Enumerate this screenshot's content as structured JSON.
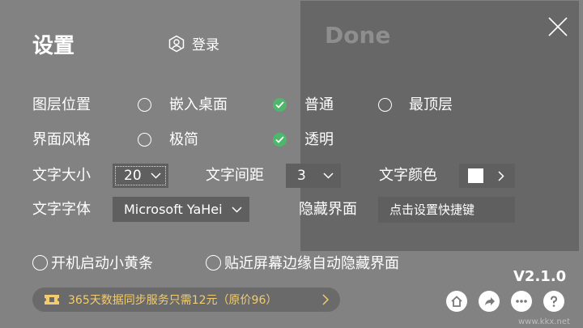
{
  "header": {
    "title": "设置",
    "login_label": "登录"
  },
  "preview": {
    "done_text": "Done"
  },
  "layer": {
    "label": "图层位置",
    "options": [
      {
        "label": "嵌入桌面",
        "checked": false
      },
      {
        "label": "普通",
        "checked": true
      },
      {
        "label": "最顶层",
        "checked": false
      }
    ]
  },
  "style": {
    "label": "界面风格",
    "options": [
      {
        "label": "极简",
        "checked": false
      },
      {
        "label": "透明",
        "checked": true
      }
    ]
  },
  "font_size": {
    "label": "文字大小",
    "value": "20"
  },
  "letter_spacing": {
    "label": "文字间距",
    "value": "3"
  },
  "text_color": {
    "label": "文字颜色",
    "value": "#ffffff"
  },
  "font_family": {
    "label": "文字字体",
    "value": "Microsoft YaHei"
  },
  "hide_ui": {
    "label": "隐藏界面",
    "hotkey_placeholder": "点击设置快捷键"
  },
  "checkboxes": {
    "autostart": {
      "label": "开机启动小黄条",
      "checked": false
    },
    "edge_hide": {
      "label": "贴近屏幕边缘自动隐藏界面",
      "checked": false
    }
  },
  "version": "V2.1.0",
  "promo": {
    "text": "365天数据同步服务只需12元（原价96）"
  },
  "watermark": "www.kkx.net",
  "colors": {
    "check_green": "#4fb76c",
    "promo_text": "#f2cc6e",
    "background": "#828282"
  },
  "footer_icons": [
    "home-icon",
    "share-icon",
    "more-icon",
    "help-icon"
  ]
}
